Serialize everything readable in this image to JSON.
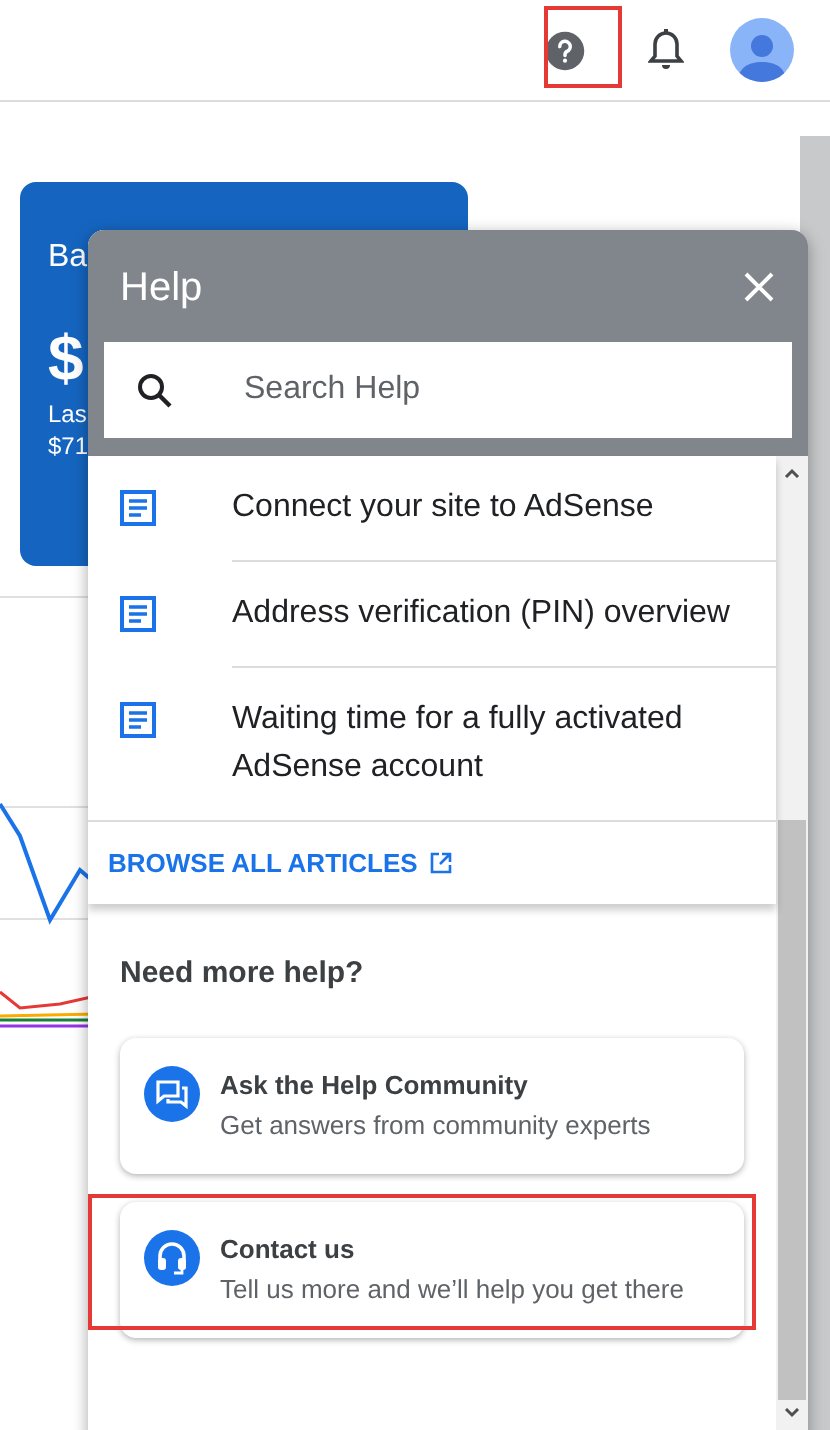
{
  "top_bar": {
    "help_highlighted": true
  },
  "background": {
    "card": {
      "title": "Ba",
      "amount": "$",
      "caption": "Las",
      "value": "$71"
    }
  },
  "help_panel": {
    "title": "Help",
    "search": {
      "placeholder": "Search Help"
    },
    "articles": [
      {
        "title": "Connect your site to AdSense"
      },
      {
        "title": "Address verification (PIN) overview"
      },
      {
        "title": "Waiting time for a fully activated AdSense account"
      }
    ],
    "browse_link": "BROWSE ALL ARTICLES",
    "more_help": {
      "heading": "Need more help?",
      "options": [
        {
          "kind": "community",
          "title": "Ask the Help Community",
          "subtitle": "Get answers from community experts",
          "highlighted": false
        },
        {
          "kind": "contact",
          "title": "Contact us",
          "subtitle": "Tell us more and we’ll help you get there",
          "highlighted": true
        }
      ]
    }
  }
}
